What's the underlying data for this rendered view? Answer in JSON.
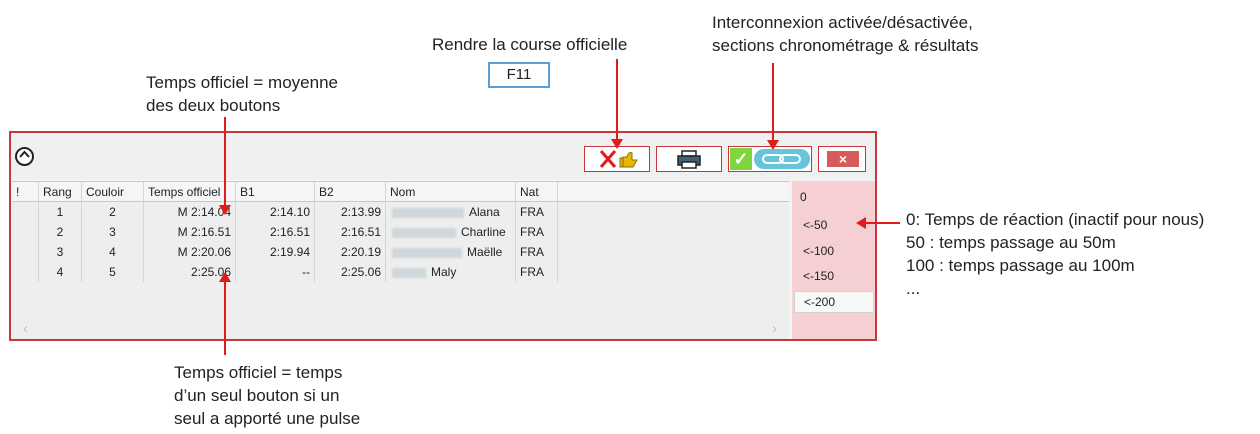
{
  "callouts": {
    "official_time_average": [
      "Temps officiel = moyenne",
      "des deux boutons"
    ],
    "make_official": "Rendre la course officielle",
    "f11": "F11",
    "interconnection": [
      "Interconnexion activée/désactivée,",
      "sections chronométrage & résultats"
    ],
    "official_time_single": [
      "Temps officiel = temps",
      "d’un seul bouton si un",
      "seul a apporté une pulse"
    ],
    "right_panel_help": [
      "0: Temps de réaction (inactif pour nous)",
      "50 : temps passage au 50m",
      "100 : temps passage au 100m",
      "..."
    ]
  },
  "table": {
    "headers": [
      "!",
      "Rang",
      "Couloir",
      "Temps officiel",
      "B1",
      "B2",
      "Nom",
      "Nat"
    ],
    "rows": [
      {
        "rank": "1",
        "lane": "2",
        "official": "M 2:14.04",
        "b1": "2:14.10",
        "b2": "2:13.99",
        "name": "Alana",
        "nat": "FRA"
      },
      {
        "rank": "2",
        "lane": "3",
        "official": "M 2:16.51",
        "b1": "2:16.51",
        "b2": "2:16.51",
        "name": "Charline",
        "nat": "FRA"
      },
      {
        "rank": "3",
        "lane": "4",
        "official": "M 2:20.06",
        "b1": "2:19.94",
        "b2": "2:20.19",
        "name": "Maëlle",
        "nat": "FRA"
      },
      {
        "rank": "4",
        "lane": "5",
        "official": "2:25.06",
        "b1": "--",
        "b2": "2:25.06",
        "name": "Maly",
        "nat": "FRA"
      }
    ]
  },
  "right_panel": {
    "top": "0",
    "splits": [
      "<-50",
      "<-100",
      "<-150",
      "<-200"
    ]
  },
  "toolbar": {
    "icons": [
      "unofficial-race-icon",
      "print-icon",
      "link-icon",
      "close-icon"
    ]
  },
  "colors": {
    "window_border": "#c8373e",
    "highlight_row": "#dff7f7",
    "arrow": "#e01b1b",
    "right_panel": "#f6d0d2"
  }
}
